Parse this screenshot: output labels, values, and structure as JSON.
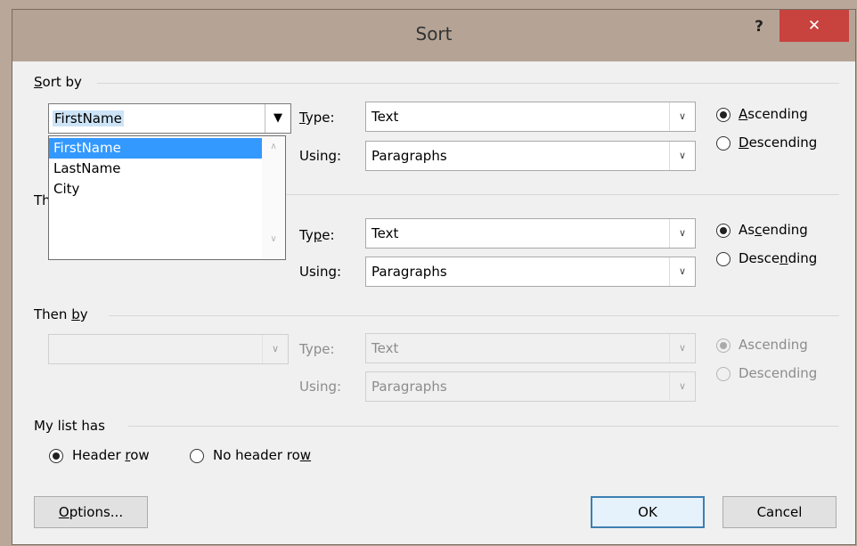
{
  "dialog": {
    "title": "Sort",
    "help_label": "?",
    "close_label": "✕"
  },
  "sort_by": {
    "section_label_u": "S",
    "section_label_rest": "ort by",
    "selected_value": "FirstName",
    "dropdown_items": [
      "FirstName",
      "LastName",
      "City"
    ],
    "type_label_u": "T",
    "type_label_rest": "ype:",
    "type_value": "Text",
    "using_label": "Using:",
    "using_value": "Paragraphs",
    "ascending_u": "A",
    "ascending_rest": "scending",
    "descending_u": "D",
    "descending_rest": "escending",
    "order": "ascending"
  },
  "then_by_1": {
    "section_label_partial": "Th",
    "type_label_a": "Ty",
    "type_label_u": "p",
    "type_label_rest": "e:",
    "type_value": "Text",
    "using_label": "Using:",
    "using_value": "Paragraphs",
    "ascending_a": "As",
    "ascending_u": "c",
    "ascending_rest": "ending",
    "descending_a": "Desce",
    "descending_u": "n",
    "descending_rest": "ding",
    "order": "ascending"
  },
  "then_by_2": {
    "section_label_a": "Then ",
    "section_label_u": "b",
    "section_label_rest": "y",
    "value": "",
    "type_label": "Type:",
    "type_value": "Text",
    "using_label": "Using:",
    "using_value": "Paragraphs",
    "ascending": "Ascending",
    "descending": "Descending",
    "order": "ascending",
    "disabled": true
  },
  "list_header": {
    "section_label": "My list has",
    "header_row_a": "Header ",
    "header_row_u": "r",
    "header_row_rest": "ow",
    "no_header_row_a": "No header ro",
    "no_header_row_u": "w",
    "selected": "header_row"
  },
  "footer": {
    "options_u": "O",
    "options_rest": "ptions...",
    "ok_label": "OK",
    "cancel_label": "Cancel"
  },
  "colors": {
    "titlebar": "#b5a496",
    "close_button": "#c8423e",
    "selection_highlight": "#3399ff",
    "default_button_border": "#3c7fb1"
  }
}
